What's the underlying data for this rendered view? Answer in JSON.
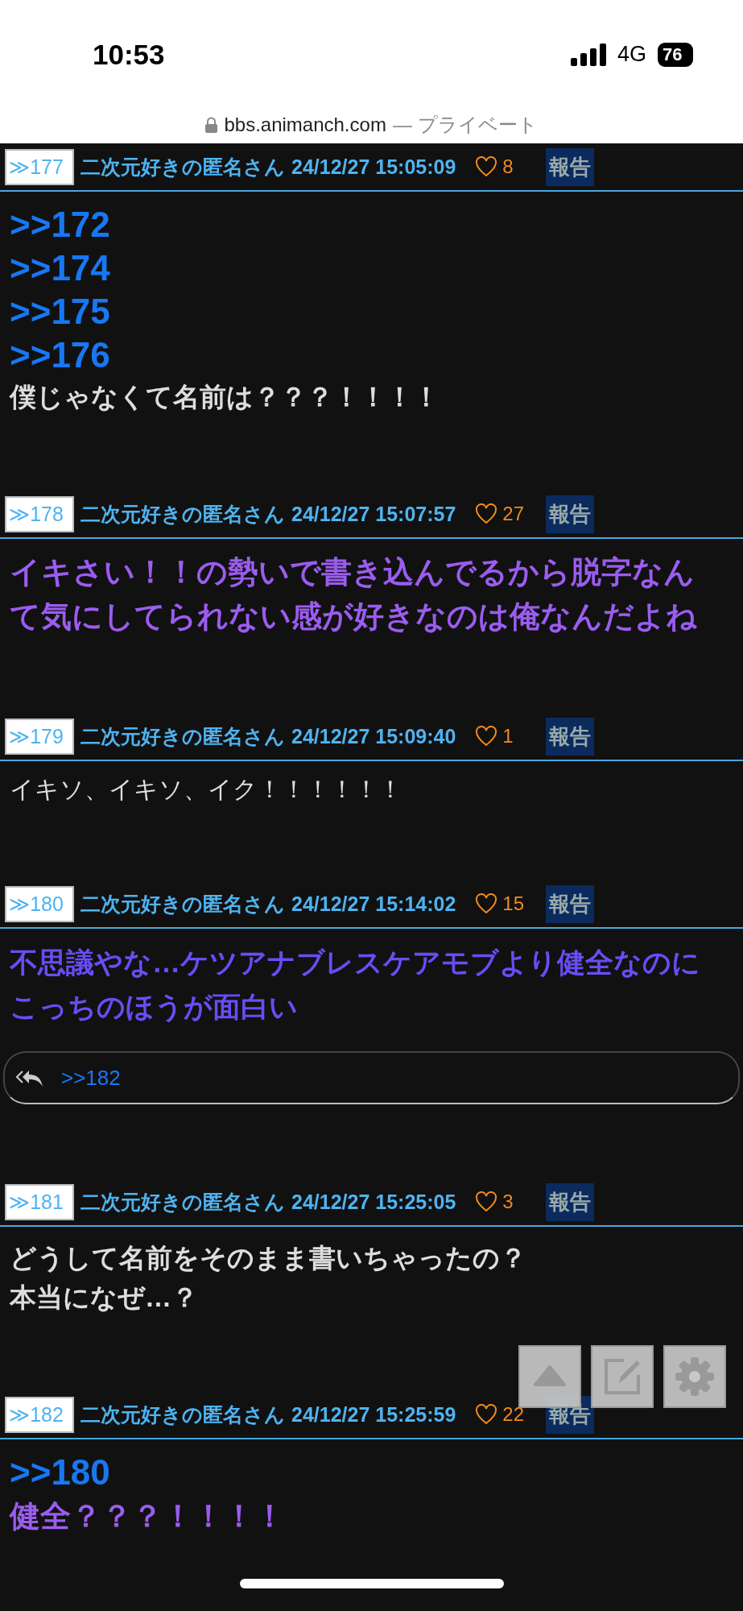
{
  "status_bar": {
    "time": "10:53",
    "network": "4G",
    "battery": "76"
  },
  "address_bar": {
    "domain": "bbs.animanch.com",
    "mode": "— プライベート"
  },
  "posts": [
    {
      "number": "≫177",
      "name": "二次元好きの匿名さん",
      "date": "24/12/27 15:05:09",
      "likes": "8",
      "report": "報告",
      "body": [
        {
          "kind": "anchor",
          "text": ">>172"
        },
        {
          "kind": "anchor",
          "text": ">>174"
        },
        {
          "kind": "anchor",
          "text": ">>175"
        },
        {
          "kind": "anchor",
          "text": ">>176"
        },
        {
          "kind": "bold",
          "text": "僕じゃなくて名前は？？？！！！！"
        }
      ]
    },
    {
      "number": "≫178",
      "name": "二次元好きの匿名さん",
      "date": "24/12/27 15:07:57",
      "likes": "27",
      "report": "報告",
      "body": [
        {
          "kind": "purple",
          "text": "イキさい！！の勢いで書き込んでるから脱字なんて気にしてられない感が好きなのは俺なんだよね"
        }
      ]
    },
    {
      "number": "≫179",
      "name": "二次元好きの匿名さん",
      "date": "24/12/27 15:09:40",
      "likes": "1",
      "report": "報告",
      "body": [
        {
          "kind": "plain",
          "text": "イキソ、イキソ、イク！！！！！！"
        }
      ]
    },
    {
      "number": "≫180",
      "name": "二次元好きの匿名さん",
      "date": "24/12/27 15:14:02",
      "likes": "15",
      "report": "報告",
      "body": [
        {
          "kind": "indigo",
          "text": "不思議やな…ケツアナブレスケアモブより健全なのにこっちのほうが面白い"
        }
      ],
      "replies": [
        ">>182"
      ]
    },
    {
      "number": "≫181",
      "name": "二次元好きの匿名さん",
      "date": "24/12/27 15:25:05",
      "likes": "3",
      "report": "報告",
      "body": [
        {
          "kind": "bold",
          "text": "どうして名前をそのまま書いちゃったの？"
        },
        {
          "kind": "bold",
          "text": "本当になぜ…？"
        }
      ]
    },
    {
      "number": "≫182",
      "name": "二次元好きの匿名さん",
      "date": "24/12/27 15:25:59",
      "likes": "22",
      "report": "報告",
      "body": [
        {
          "kind": "anchor",
          "text": ">>180"
        },
        {
          "kind": "purple",
          "text": "健全？？？！！！！"
        }
      ]
    }
  ]
}
